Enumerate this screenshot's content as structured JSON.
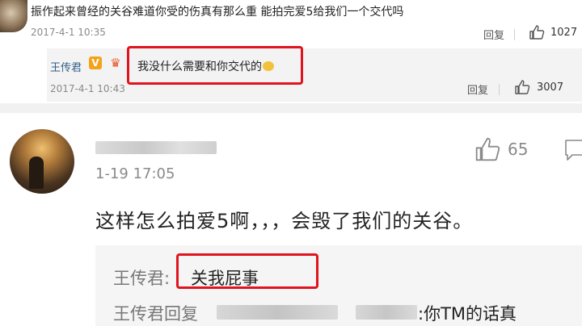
{
  "comment_top": {
    "text": "振作起来曾经的关谷难道你受的伤真有那么重 能拍完爱5给我们一个交代吗",
    "time": "2017-4-1 10:35",
    "reply_label": "回复",
    "like_count": "1027",
    "icon": "thumbs-up-icon"
  },
  "reply_top": {
    "author": "王传君",
    "badge": "V",
    "text": "我没什么需要和你交代的",
    "time": "2017-4-1 10:43",
    "reply_label": "回复",
    "like_count": "3007"
  },
  "comment_bottom": {
    "time": "1-19 17:05",
    "like_count": "65",
    "text": "这样怎么拍爱5啊，，，会毁了我们的关谷。",
    "sub_replies": [
      {
        "author": "王传君",
        "separator": ":",
        "text": "关我屁事"
      },
      {
        "author": "王传君回复",
        "separator": ":",
        "text": "你TM的话真"
      }
    ]
  },
  "colors": {
    "highlight": "#e0141e",
    "author_link": "#2f5e8a",
    "badge": "#f4a21a"
  }
}
